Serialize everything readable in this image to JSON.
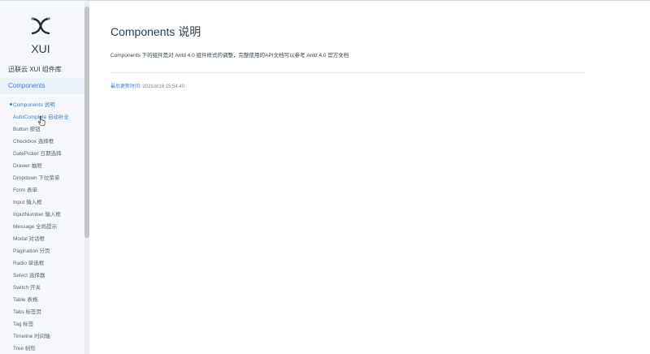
{
  "sidebar": {
    "brand": "XUI",
    "site_title": "迅联云 XUI 组件库",
    "section": "Components",
    "items": [
      {
        "label": "Components 说明"
      },
      {
        "label": "AutoComplete 自动补全"
      },
      {
        "label": "Button 按钮"
      },
      {
        "label": "Checkbox 选择框"
      },
      {
        "label": "DatePicker 日期选择"
      },
      {
        "label": "Drawer 抽屉"
      },
      {
        "label": "Dropdown 下拉菜单"
      },
      {
        "label": "Form 表单"
      },
      {
        "label": "Input 输入框"
      },
      {
        "label": "InputNumber 输入框"
      },
      {
        "label": "Message 全局提示"
      },
      {
        "label": "Modal 对话框"
      },
      {
        "label": "Pagination 分页"
      },
      {
        "label": "Radio 单选框"
      },
      {
        "label": "Select 选择器"
      },
      {
        "label": "Switch 开关"
      },
      {
        "label": "Table 表格"
      },
      {
        "label": "Tabs 标签页"
      },
      {
        "label": "Tag 标签"
      },
      {
        "label": "Timeline 时间轴"
      },
      {
        "label": "Tree 树形"
      }
    ]
  },
  "main": {
    "title": "Components 说明",
    "description": "Components 下的组件是对 Antd 4.0 组件样式的调整，完整使用的API文档可以参考 Antd 4.0 官方文档",
    "updated_label": "最后更新时间:",
    "updated_value": "2021/8/16 15:54:40"
  },
  "colors": {
    "accent": "#3d7fd6",
    "sidebar_bg": "#f5f7fa",
    "text": "#2c3e50"
  }
}
